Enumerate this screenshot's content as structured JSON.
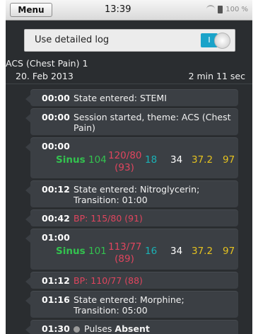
{
  "status_bar": {
    "menu_label": "Menu",
    "time": "13:39",
    "battery_percent": "100 %"
  },
  "log_toggle": {
    "label": "Use detailed log",
    "state_label": "I"
  },
  "session": {
    "title": "ACS (Chest Pain) 1",
    "date": "20. Feb 2013",
    "duration": "2 min 11 sec"
  },
  "entries": [
    {
      "time": "00:00",
      "text": "State entered: STEMI"
    },
    {
      "time": "00:00",
      "text": "Session started, theme: ACS (Chest Pain)"
    },
    {
      "time": "00:00",
      "vitals": {
        "rhythm": "Sinus",
        "hr": "104",
        "bp": "120/80",
        "map": "(93)",
        "spo2": "18",
        "rr": "34",
        "temp": "37.2",
        "etco2": "97"
      }
    },
    {
      "time": "00:12",
      "text": "State entered: Nitroglycerin; Transition: 01:00"
    },
    {
      "time": "00:42",
      "text": "BP: 115/80 (91)"
    },
    {
      "time": "01:00",
      "vitals": {
        "rhythm": "Sinus",
        "hr": "101",
        "bp": "113/77",
        "map": "(89)",
        "spo2": "16",
        "rr": "34",
        "temp": "37.2",
        "etco2": "97"
      }
    },
    {
      "time": "01:12",
      "text": "BP: 110/77 (88)"
    },
    {
      "time": "01:16",
      "text": "State entered: Morphine; Transition: 05:00"
    },
    {
      "time": "01:30",
      "text_prefix": "Pulses",
      "text_bold": "Absent"
    }
  ]
}
